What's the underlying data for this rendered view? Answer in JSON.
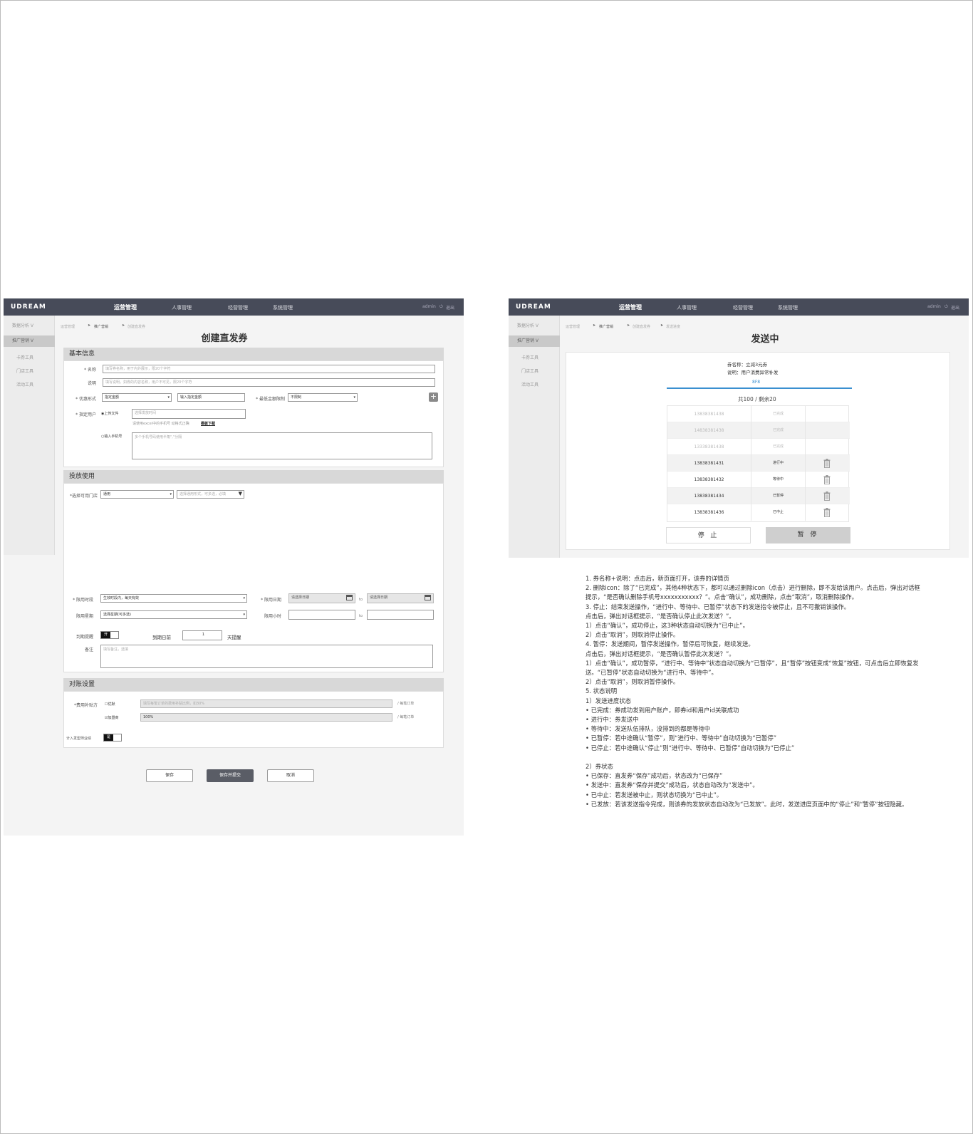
{
  "app": {
    "logo": "UDREAM",
    "nav": [
      "运营管理",
      "人事管理",
      "经营管理",
      "系统管理"
    ],
    "admin": "admin",
    "logout": "退出",
    "sidebar": {
      "groups": [
        "数据分析  V",
        "推广营销  V"
      ],
      "subitems": [
        "卡券工具",
        "门店工具",
        "活动工具"
      ]
    }
  },
  "left": {
    "breadcrumb": [
      "运营管理",
      "推广营销",
      "创建直发券"
    ],
    "title": "创建直发券",
    "basic": {
      "header": "基本信息",
      "name_label": "* 名称",
      "name_placeholder": "填写券名称，用于内外展示，限20个字符",
      "desc_label": "说明",
      "desc_placeholder": "填写说明，如券的内容名称，用户不可见，限20个字符",
      "discount_label": "* 优惠形式",
      "discount_value": "指定金额",
      "amount_placeholder": "输入指定金额",
      "min_label": "* 最低金额限制",
      "min_value": "不限制",
      "user_label": "* 指定用户",
      "upload_option": "◉上传文件",
      "upload_placeholder": "选择发放时间",
      "upload_hint": "请使用excel中的手机号 动格式正确",
      "template_link": "模板下载",
      "phone_option": "○输入手机号",
      "phone_placeholder": "多个手机号码使用半角\",\"分隔"
    },
    "usage": {
      "header": "投放使用",
      "store_label": "*选择可用门店",
      "store_value": "通用",
      "store_mode_placeholder": "选择通用形式，可多选，必填",
      "time_label": "* 限用时段",
      "time_value": "生效时段内，每天有效",
      "date_label": "* 限用日期",
      "start_date_placeholder": "请选择日期",
      "to1": "to",
      "end_date_placeholder": "请选择日期",
      "week_label": "限用星期",
      "week_value": "选择星期(可多选)",
      "hour_label": "限用小时",
      "to2": "to",
      "expire_label": "到期提醒",
      "expire_toggle": "开",
      "before_label": "到期日前",
      "days_value": "1",
      "days_suffix": "天提醒",
      "remark_label": "备注",
      "remark_placeholder": "填写备注，选填"
    },
    "recon": {
      "header": "对账设置",
      "payer_label": "*费用补贴方",
      "option1": "☐优默",
      "option1_placeholder": "填写每笔订单的费用补贴比例，如30%",
      "option2": "☑加盟商",
      "option2_value": "100%",
      "per_order1": "/ 每笔订单",
      "per_order2": "/ 每笔订单",
      "count_label": "计入发型师业绩",
      "count_toggle": "是"
    },
    "buttons": {
      "save": "保存",
      "save_submit": "保存并提交",
      "cancel": "取消"
    }
  },
  "right": {
    "breadcrumb": [
      "运营管理",
      "推广营销",
      "创建直发券",
      "发送进度"
    ],
    "title": "发送中",
    "coupon_name": "券名称：立减3元券",
    "coupon_desc": "说明：用户消费异常补发",
    "percent": "8F8",
    "summary": "共100 / 剩余20",
    "rows": [
      {
        "phone": "13838381438",
        "status": "已完成",
        "active": false,
        "trash": false
      },
      {
        "phone": "14838381438",
        "status": "已完成",
        "active": false,
        "trash": false
      },
      {
        "phone": "13338381438",
        "status": "已完成",
        "active": false,
        "trash": false
      },
      {
        "phone": "13838381431",
        "status": "进行中",
        "active": true,
        "trash": true
      },
      {
        "phone": "13838381432",
        "status": "等待中",
        "active": true,
        "trash": true
      },
      {
        "phone": "13838381434",
        "status": "已暂停",
        "active": true,
        "trash": true
      },
      {
        "phone": "13838381436",
        "status": "已中止",
        "active": true,
        "trash": true
      }
    ],
    "stop_label": "停 止",
    "pause_label": "暂 停"
  },
  "notes": [
    "1. 券名称+说明：点击后，新页面打开，该券的详情页",
    "2. 删除icon：除了“已完成”，其他4种状态下，都可以通过删除icon（点击）进行删除，即不发给该用户。点击后，弹出对话框提示，“是否确认删除手机号xxxxxxxxxxx？”。点击“确认”，成功删除，点击“取消”，取消删除操作。",
    "3. 停止：结束发送操作，“进行中、等待中、已暂停”状态下的发送指令被停止，且不可撤销该操作。",
    "点击后，弹出对话框提示，“是否确认停止此次发送？”。",
    "  1）点击“确认”，成功停止，这3种状态自动切换为“已中止”。",
    "  2）点击“取消”，则取消停止操作。",
    "4. 暂停：发送期间，暂停发送操作。暂停后可恢复，继续发送。",
    "点击后，弹出对话框提示，“是否确认暂停此次发送？”。",
    "  1）点击“确认”，成功暂停，“进行中、等待中”状态自动切换为“已暂停”，且“暂停”按钮变成“恢复”按钮，可点击后立即恢复发送。“已暂停”状态自动切换为“进行中、等待中”。",
    "  2）点击“取消”，则取消暂停操作。",
    "5. 状态说明",
    "1）发送进度状态",
    "• 已完成：券成功发到用户账户，即券id和用户id关联成功",
    "• 进行中：券发送中",
    "• 等待中：发送队伍排队，没排到的都是等待中",
    "• 已暂停：若中途确认“暂停”，则“进行中、等待中”自动切换为“已暂停”",
    "• 已停止：若中途确认“停止”则“进行中、等待中、已暂停”自动切换为“已停止”",
    "",
    "2）券状态",
    "• 已保存：直发券“保存”成功后，状态改为“已保存”",
    "• 发送中：直发券“保存并提交”成功后，状态自动改为“发送中”。",
    "• 已中止：若发送被中止，则状态切换为“已中止”。",
    "• 已发放：若该发送指令完成，则该券的发放状态自动改为“已发放”。此时，发送进度页面中的“停止”和“暂停”按钮隐藏。"
  ]
}
